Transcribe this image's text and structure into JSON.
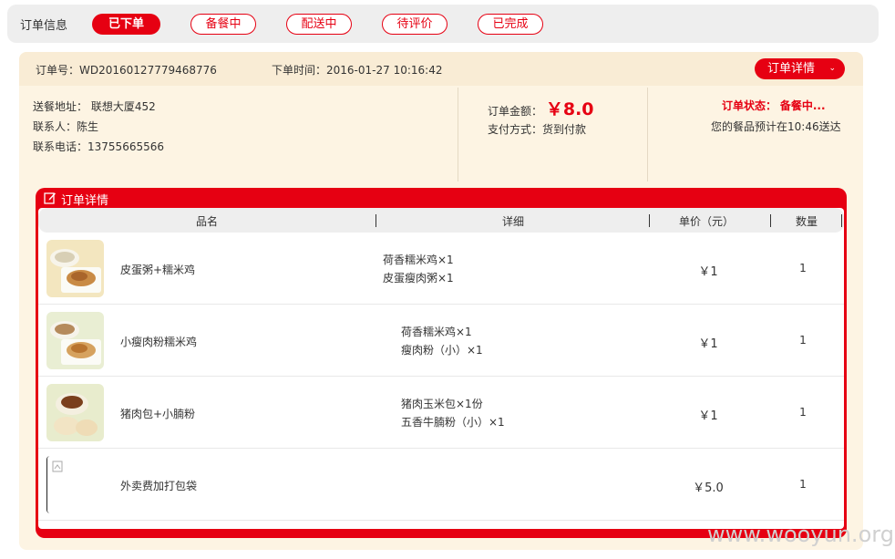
{
  "status_bar": {
    "label": "订单信息",
    "tabs": [
      {
        "label": "已下单",
        "active": true
      },
      {
        "label": "备餐中",
        "active": false
      },
      {
        "label": "配送中",
        "active": false
      },
      {
        "label": "待评价",
        "active": false
      },
      {
        "label": "已完成",
        "active": false
      }
    ]
  },
  "order": {
    "number_label": "订单号：",
    "number": "WD20160127779468776",
    "time_label": "下单时间：",
    "time": "2016-01-27 10:16:42",
    "detail_button": "订单详情",
    "address_label": "送餐地址：",
    "address": "联想大厦452",
    "contact_label": "联系人：",
    "contact": "陈生",
    "phone_label": "联系电话：",
    "phone": "13755665566",
    "amount_label": "订单金额：",
    "amount": "￥8.0",
    "payment_label": "支付方式：",
    "payment": "货到付款",
    "status_label": "订单状态：",
    "status": "备餐中...",
    "eta_text": "您的餐品预计在10:46送达"
  },
  "detail_panel": {
    "title": "订单详情",
    "columns": [
      "品名",
      "详细",
      "单价（元）",
      "数量"
    ],
    "rows": [
      {
        "name": "皮蛋粥+糯米鸡",
        "details": [
          "荷香糯米鸡×1",
          "皮蛋瘦肉粥×1"
        ],
        "price": "￥1",
        "qty": "1"
      },
      {
        "name": "小瘦肉粉糯米鸡",
        "details": [
          "荷香糯米鸡×1",
          "瘦肉粉（小）×1"
        ],
        "price": "￥1",
        "qty": "1"
      },
      {
        "name": "猪肉包+小腩粉",
        "details": [
          "猪肉玉米包×1份",
          "五香牛腩粉（小）×1"
        ],
        "price": "￥1",
        "qty": "1"
      },
      {
        "name": "外卖费加打包袋",
        "details": [],
        "price": "￥5.0",
        "qty": "1"
      }
    ]
  },
  "watermark": "www.wooyun.org",
  "colors": {
    "accent": "#e60012",
    "card": "#fdf4e3",
    "card_head": "#f9ecd5"
  }
}
